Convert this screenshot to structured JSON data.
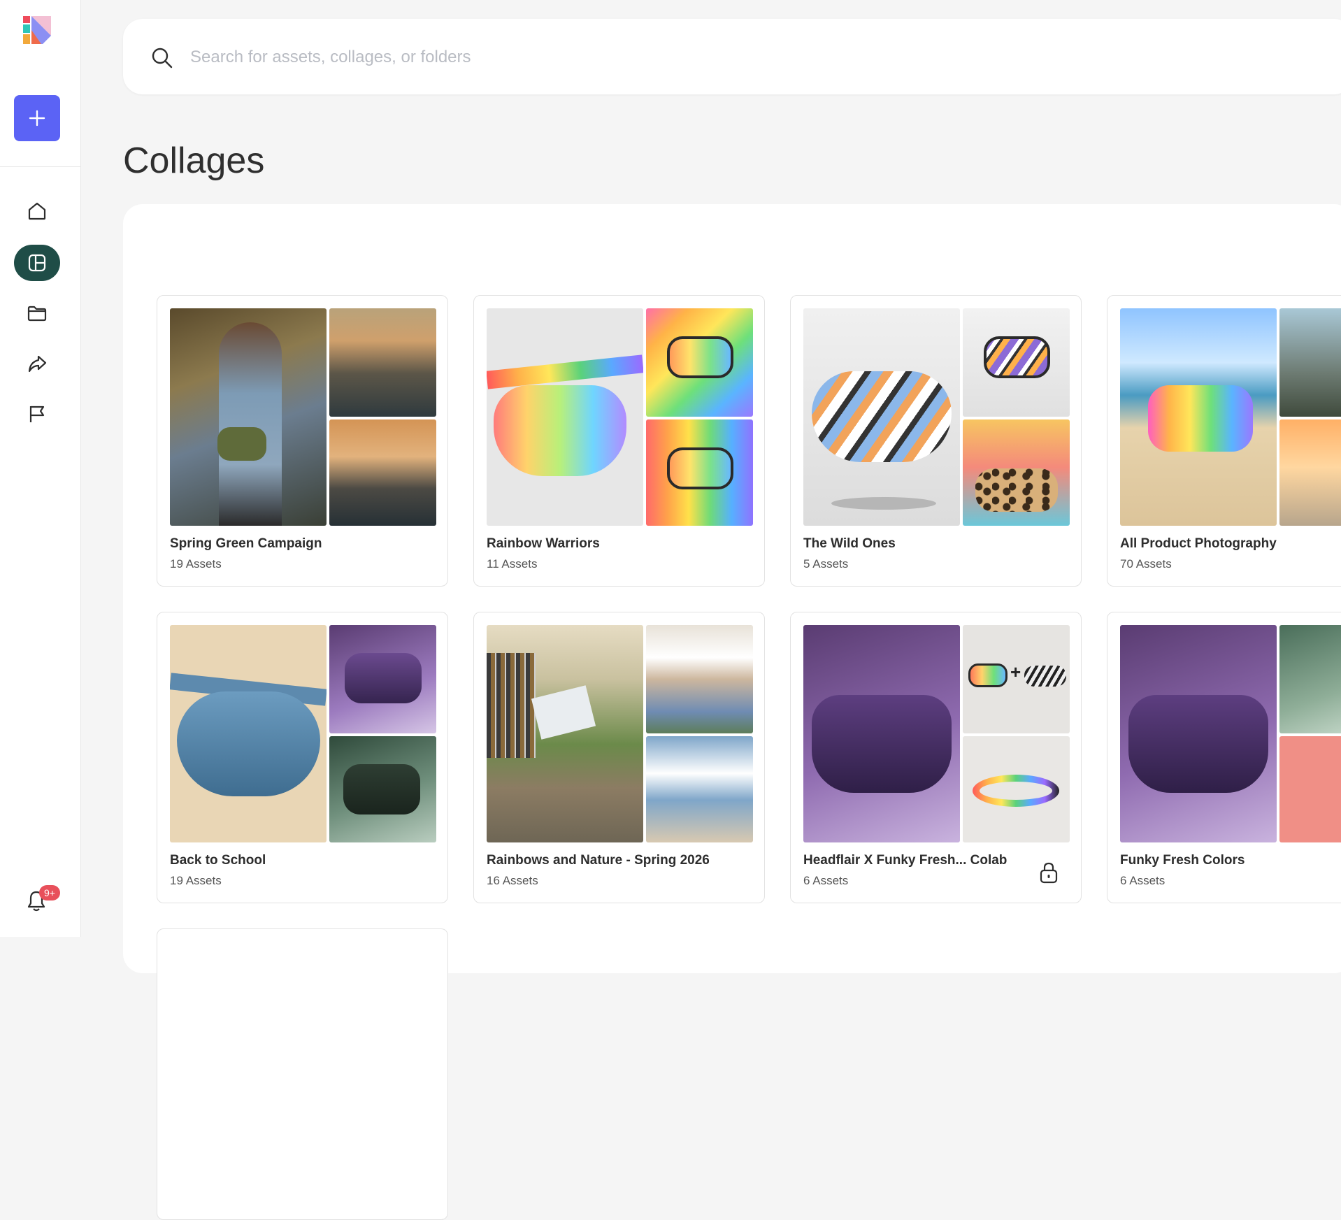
{
  "search": {
    "placeholder": "Search for assets, collages, or folders"
  },
  "page": {
    "title": "Collages"
  },
  "notifications": {
    "badge": "9+"
  },
  "sidebar": {
    "new_button_icon": "plus-icon",
    "items": [
      {
        "name": "home",
        "icon": "home-icon",
        "active": false
      },
      {
        "name": "collages",
        "icon": "collage-icon",
        "active": true
      },
      {
        "name": "folders",
        "icon": "folder-icon",
        "active": false
      },
      {
        "name": "shared",
        "icon": "share-icon",
        "active": false
      },
      {
        "name": "flagged",
        "icon": "flag-icon",
        "active": false
      }
    ]
  },
  "collages": [
    {
      "title": "Spring Green Campaign",
      "count": "19 Assets"
    },
    {
      "title": "Rainbow Warriors",
      "count": "11 Assets"
    },
    {
      "title": "The Wild Ones",
      "count": "5 Assets"
    },
    {
      "title": "All Product Photography",
      "count": "70 Assets"
    },
    {
      "title": "Back to School",
      "count": "19 Assets"
    },
    {
      "title": "Rainbows and Nature - Spring 2026",
      "count": "16 Assets"
    },
    {
      "title": "Headflair X Funky Fresh... Colab",
      "count": "6 Assets",
      "locked": true
    },
    {
      "title": "Funky Fresh Colors",
      "count": "6 Assets"
    }
  ],
  "colors": {
    "accent": "#5b63f5",
    "active_nav": "#1f4d47",
    "badge": "#e8505b"
  }
}
